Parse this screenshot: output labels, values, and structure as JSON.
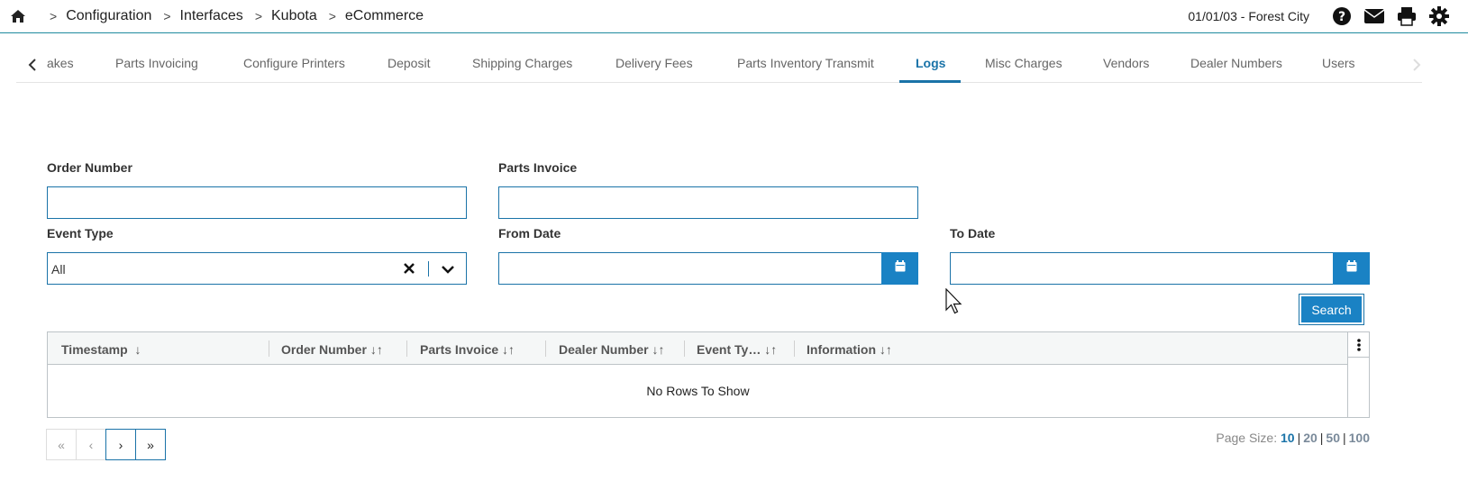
{
  "breadcrumb": {
    "items": [
      "Configuration",
      "Interfaces",
      "Kubota",
      "eCommerce"
    ],
    "separator": ">"
  },
  "header": {
    "location": "01/01/03 - Forest City",
    "icons": [
      "home-icon",
      "help-icon",
      "mail-icon",
      "print-icon",
      "gear-icon"
    ]
  },
  "tabs": [
    {
      "label": "akes"
    },
    {
      "label": "Parts Invoicing"
    },
    {
      "label": "Configure Printers"
    },
    {
      "label": "Deposit"
    },
    {
      "label": "Shipping Charges"
    },
    {
      "label": "Delivery Fees"
    },
    {
      "label": "Parts Inventory Transmit"
    },
    {
      "label": "Logs"
    },
    {
      "label": "Misc Charges"
    },
    {
      "label": "Vendors"
    },
    {
      "label": "Dealer Numbers"
    },
    {
      "label": "Users"
    }
  ],
  "form": {
    "order_number": {
      "label": "Order Number",
      "value": ""
    },
    "parts_invoice": {
      "label": "Parts Invoice",
      "value": ""
    },
    "event_type": {
      "label": "Event Type",
      "value": "All"
    },
    "from_date": {
      "label": "From Date",
      "value": ""
    },
    "to_date": {
      "label": "To Date",
      "value": ""
    },
    "search_label": "Search"
  },
  "grid": {
    "columns": [
      {
        "label": "Timestamp",
        "sort": "↓"
      },
      {
        "label": "Order Number",
        "sort": "↓↑"
      },
      {
        "label": "Parts Invoice",
        "sort": "↓↑"
      },
      {
        "label": "Dealer Number",
        "sort": "↓↑"
      },
      {
        "label": "Event Ty…",
        "sort": "↓↑"
      },
      {
        "label": "Information",
        "sort": "↓↑"
      }
    ],
    "empty_text": "No Rows To Show"
  },
  "pager": {
    "first": "«",
    "prev": "‹",
    "next": "›",
    "last": "»",
    "page_size_label": "Page Size:",
    "sizes": [
      "10",
      "20",
      "50",
      "100"
    ],
    "selected": "10"
  },
  "colors": {
    "accent": "#1a73a8",
    "button": "#1a82c4"
  }
}
